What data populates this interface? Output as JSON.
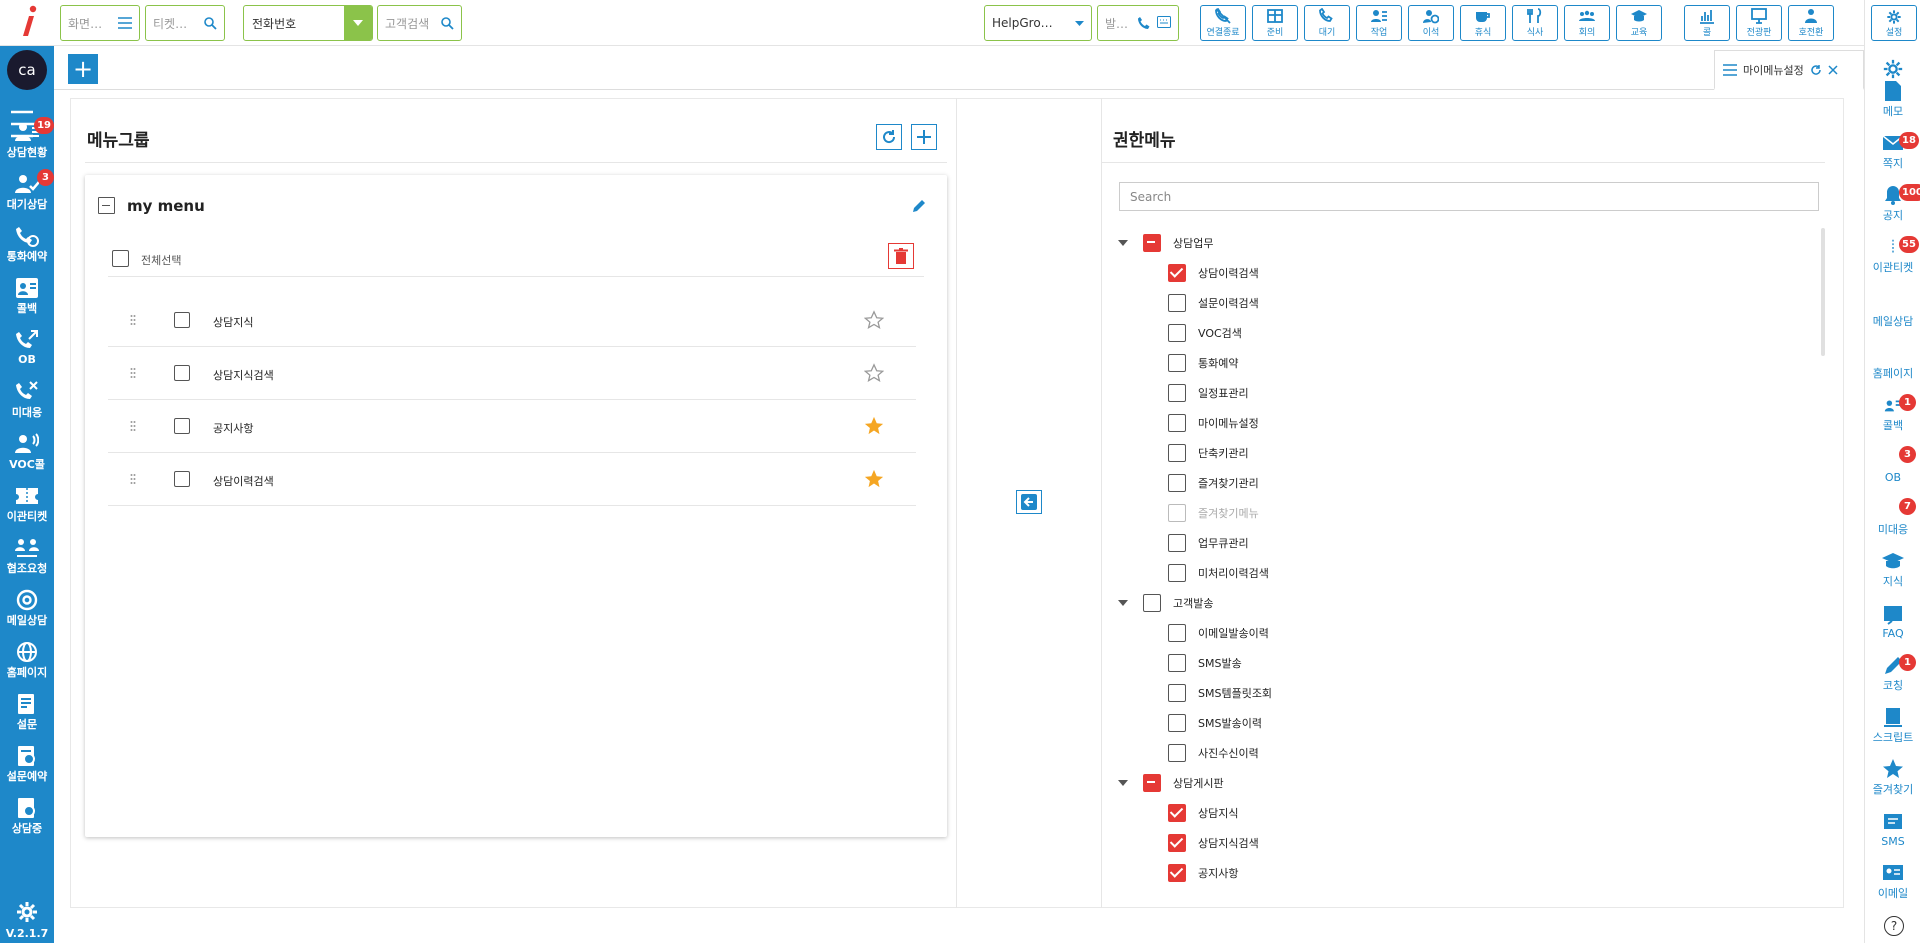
{
  "topbar": {
    "screen_search_placeholder": "화면…",
    "ticket_search_placeholder": "티켓…",
    "phone_select": "전화번호",
    "customer_search_placeholder": "고객검색",
    "helpgroup_select": "HelpGro…",
    "outbound_placeholder": "발…",
    "buttons": [
      {
        "label": "연결종료",
        "icon": "disconnect-icon"
      },
      {
        "label": "준비",
        "icon": "grid-icon"
      },
      {
        "label": "대기",
        "icon": "phone-icon"
      },
      {
        "label": "작업",
        "icon": "work-icon"
      },
      {
        "label": "이석",
        "icon": "away-icon"
      },
      {
        "label": "휴식",
        "icon": "coffee-icon"
      },
      {
        "label": "식사",
        "icon": "meal-icon"
      },
      {
        "label": "회의",
        "icon": "meeting-icon"
      },
      {
        "label": "교육",
        "icon": "education-icon"
      },
      {
        "label": "콜",
        "icon": "chart-icon"
      },
      {
        "label": "전광판",
        "icon": "monitor-icon"
      },
      {
        "label": "호전환",
        "icon": "transfer-icon"
      }
    ],
    "settings_label": "설정"
  },
  "left_sidebar": {
    "avatar": "ca",
    "items": [
      {
        "label": "상담현황",
        "badge": "19",
        "icon": "consult-status-icon"
      },
      {
        "label": "대기상담",
        "badge": "3",
        "icon": "waiting-icon"
      },
      {
        "label": "통화예약",
        "badge": "",
        "icon": "reservation-icon"
      },
      {
        "label": "콜백",
        "badge": "",
        "icon": "callback-icon"
      },
      {
        "label": "OB",
        "badge": "",
        "icon": "outbound-icon"
      },
      {
        "label": "미대응",
        "badge": "",
        "icon": "missed-icon"
      },
      {
        "label": "VOC콜",
        "badge": "",
        "icon": "voc-icon"
      },
      {
        "label": "이관티켓",
        "badge": "",
        "icon": "ticket-icon"
      },
      {
        "label": "협조요청",
        "badge": "",
        "icon": "cooperation-icon"
      },
      {
        "label": "메일상담",
        "badge": "",
        "icon": "mail-at-icon"
      },
      {
        "label": "홈페이지",
        "badge": "",
        "icon": "globe-icon"
      },
      {
        "label": "설문",
        "badge": "",
        "icon": "survey-icon"
      },
      {
        "label": "설문예약",
        "badge": "",
        "icon": "survey-reserve-icon"
      },
      {
        "label": "상담중",
        "badge": "",
        "icon": "in-consult-icon"
      }
    ],
    "version": "V.2.1.7"
  },
  "right_sidebar": {
    "items": [
      {
        "label": "메모",
        "badge": "",
        "icon": "memo-icon"
      },
      {
        "label": "쪽지",
        "badge": "18",
        "icon": "message-icon"
      },
      {
        "label": "공지",
        "badge": "100",
        "icon": "bell-icon"
      },
      {
        "label": "이관티켓",
        "badge": "55",
        "icon": "ticket-icon"
      },
      {
        "label": "메일상담",
        "badge": "",
        "icon": "mail-at-icon"
      },
      {
        "label": "홈페이지",
        "badge": "",
        "icon": "globe-icon"
      },
      {
        "label": "콜백",
        "badge": "1",
        "icon": "callback-icon"
      },
      {
        "label": "OB",
        "badge": "3",
        "icon": "outbound-icon"
      },
      {
        "label": "미대응",
        "badge": "7",
        "icon": "missed-icon"
      },
      {
        "label": "지식",
        "badge": "",
        "icon": "knowledge-icon"
      },
      {
        "label": "FAQ",
        "badge": "",
        "icon": "faq-icon"
      },
      {
        "label": "코칭",
        "badge": "1",
        "icon": "coaching-icon"
      },
      {
        "label": "스크립트",
        "badge": "",
        "icon": "script-icon"
      },
      {
        "label": "즐겨찾기",
        "badge": "",
        "icon": "star-icon"
      },
      {
        "label": "SMS",
        "badge": "",
        "icon": "sms-icon"
      },
      {
        "label": "이메일",
        "badge": "",
        "icon": "email-icon"
      }
    ]
  },
  "tab": {
    "label": "마이메뉴설정"
  },
  "menu_group": {
    "title": "메뉴그룹",
    "group_name": "my menu",
    "select_all": "전체선택",
    "items": [
      {
        "label": "상담지식",
        "favorite": false
      },
      {
        "label": "상담지식검색",
        "favorite": false
      },
      {
        "label": "공지사항",
        "favorite": true
      },
      {
        "label": "상담이력검색",
        "favorite": true
      }
    ]
  },
  "permission_menu": {
    "title": "권한메뉴",
    "search_placeholder": "Search",
    "groups": [
      {
        "label": "상담업무",
        "state": "indeterminate",
        "children": [
          {
            "label": "상담이력검색",
            "state": "checked"
          },
          {
            "label": "설문이력검색",
            "state": "unchecked"
          },
          {
            "label": "VOC검색",
            "state": "unchecked"
          },
          {
            "label": "통화예약",
            "state": "unchecked"
          },
          {
            "label": "일정표관리",
            "state": "unchecked"
          },
          {
            "label": "마이메뉴설정",
            "state": "unchecked"
          },
          {
            "label": "단축키관리",
            "state": "unchecked"
          },
          {
            "label": "즐겨찾기관리",
            "state": "unchecked"
          },
          {
            "label": "즐겨찾기메뉴",
            "state": "disabled"
          },
          {
            "label": "업무큐관리",
            "state": "unchecked"
          },
          {
            "label": "미처리이력검색",
            "state": "unchecked"
          }
        ]
      },
      {
        "label": "고객발송",
        "state": "unchecked",
        "children": [
          {
            "label": "이메일발송이력",
            "state": "unchecked"
          },
          {
            "label": "SMS발송",
            "state": "unchecked"
          },
          {
            "label": "SMS템플릿조회",
            "state": "unchecked"
          },
          {
            "label": "SMS발송이력",
            "state": "unchecked"
          },
          {
            "label": "사진수신이력",
            "state": "unchecked"
          }
        ]
      },
      {
        "label": "상담게시판",
        "state": "indeterminate",
        "children": [
          {
            "label": "상담지식",
            "state": "checked"
          },
          {
            "label": "상담지식검색",
            "state": "checked"
          },
          {
            "label": "공지사항",
            "state": "checked"
          }
        ]
      }
    ]
  },
  "colors": {
    "primary": "#1e88c9",
    "accent_green": "#8bc34a",
    "danger": "#e53935",
    "star": "#f5a623"
  }
}
